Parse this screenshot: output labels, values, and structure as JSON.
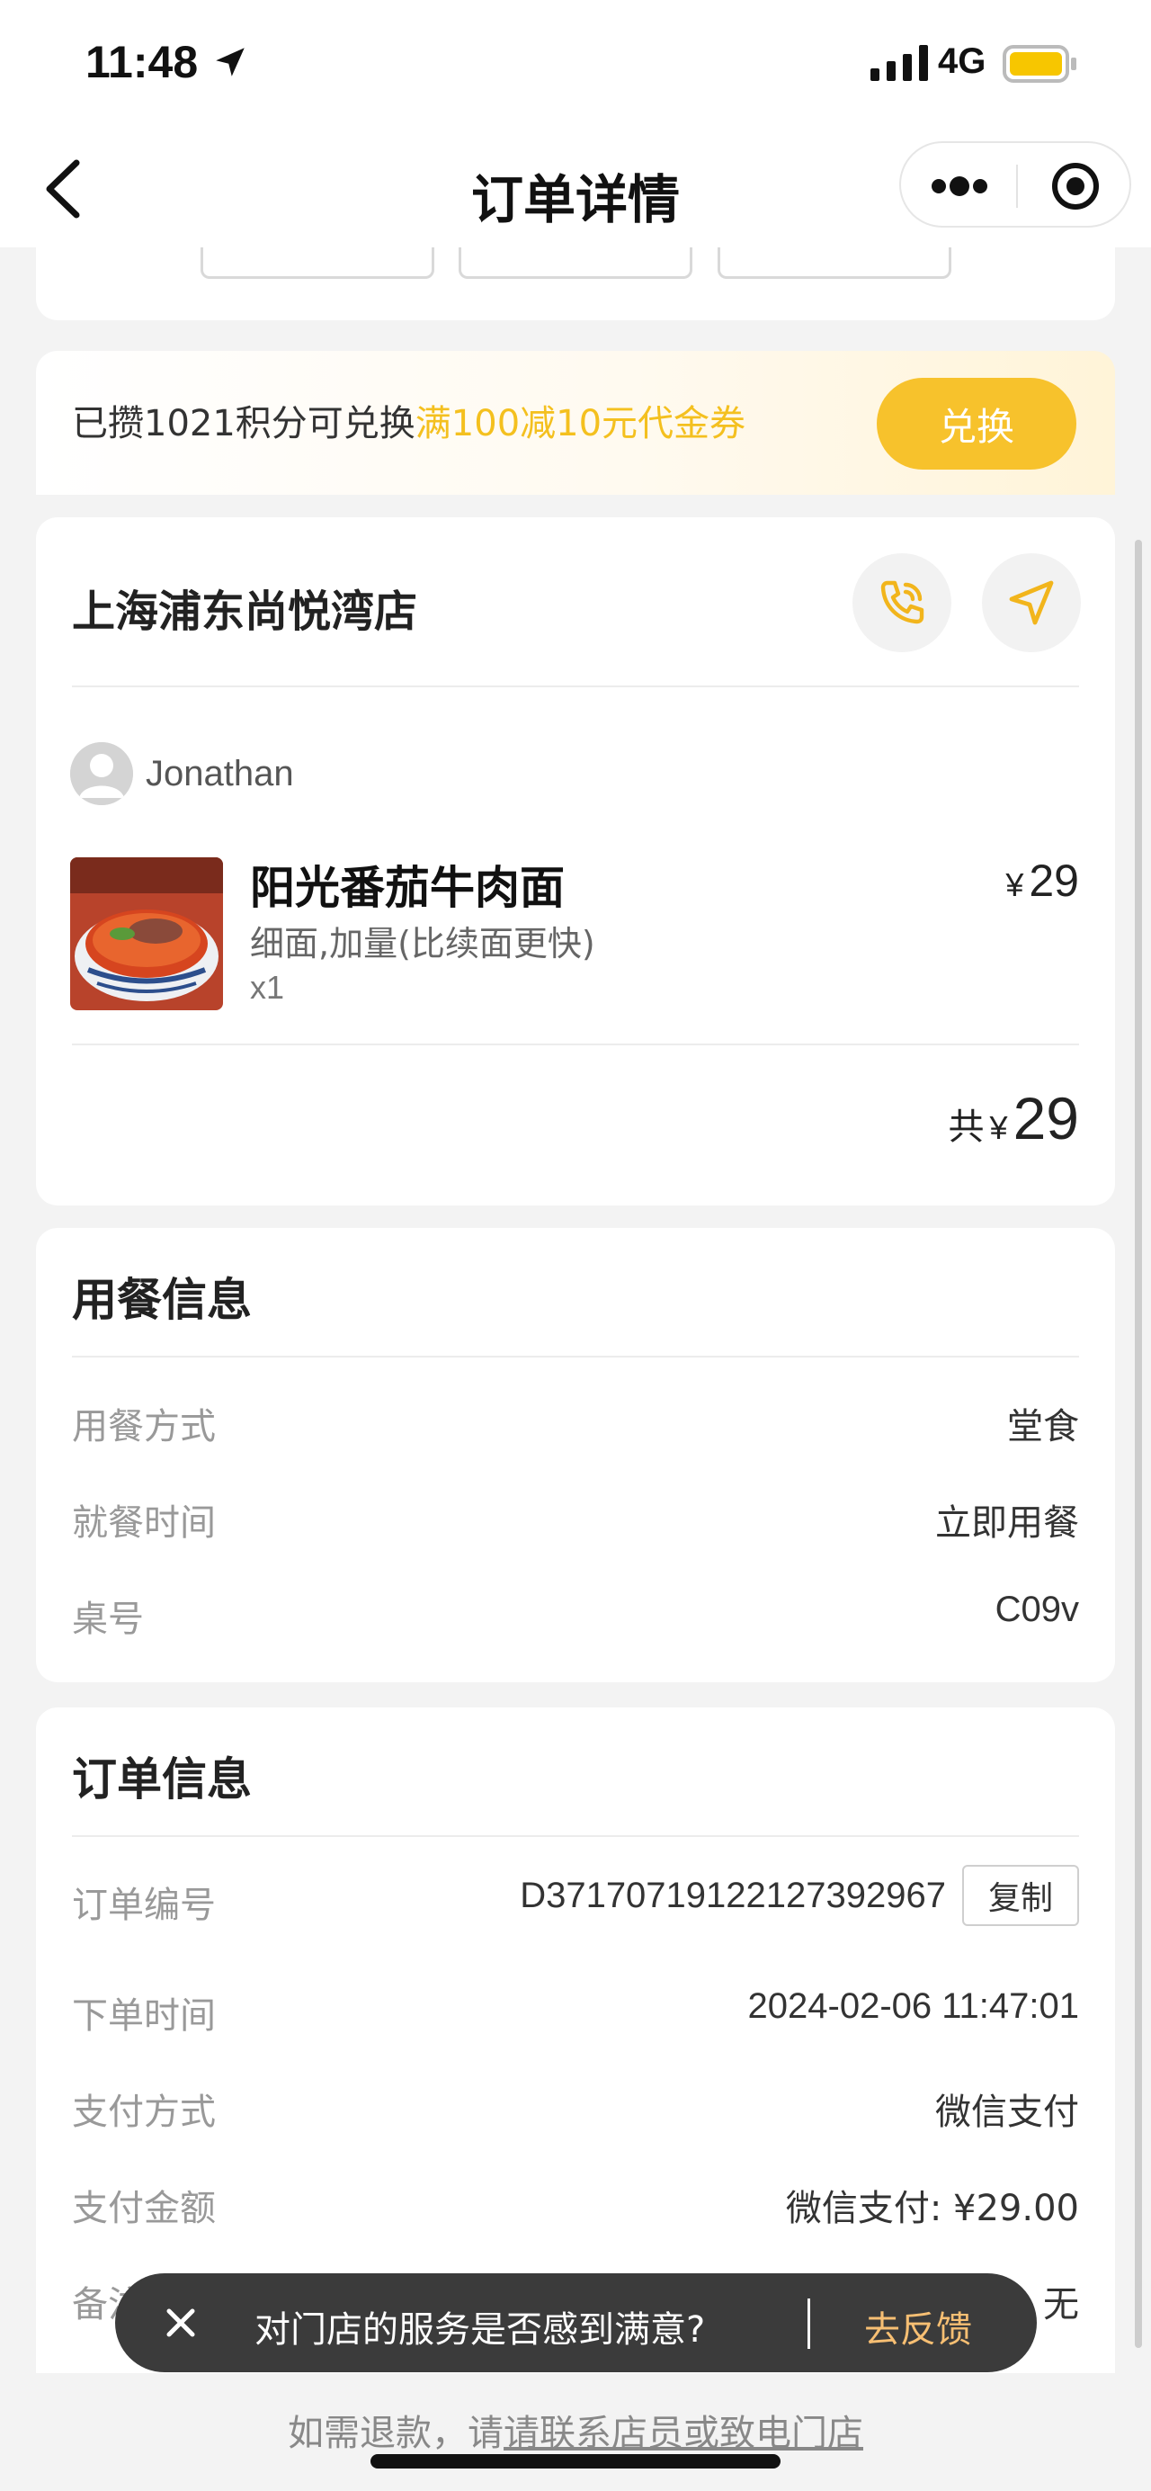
{
  "status_bar": {
    "time": "11:48",
    "network": "4G",
    "icons": [
      "location-arrow-icon",
      "signal-icon",
      "battery-icon"
    ],
    "battery_color": "#f7c600"
  },
  "nav": {
    "title": "订单详情",
    "icons": [
      "back-icon",
      "more-icon",
      "close-icon"
    ]
  },
  "points_banner": {
    "text_prefix": "已攒1021积分可兑换",
    "text_highlight": "满100减10元代金券",
    "redeem_label": "兑换",
    "accent": "#f7c22c"
  },
  "store": {
    "name": "上海浦东尚悦湾店",
    "icons": [
      "phone-icon",
      "navigation-icon"
    ],
    "user_name": "Jonathan",
    "item": {
      "name": "阳光番茄牛肉面",
      "options": "细面,加量(比续面更快)",
      "qty": "x1",
      "currency": "¥",
      "price": "29"
    },
    "total_label": "共",
    "total_currency": "¥",
    "total_amount": "29"
  },
  "dining": {
    "title": "用餐信息",
    "rows": [
      {
        "label": "用餐方式",
        "value": "堂食"
      },
      {
        "label": "就餐时间",
        "value": "立即用餐"
      },
      {
        "label": "桌号",
        "value": "C09v"
      }
    ]
  },
  "order": {
    "title": "订单信息",
    "order_no_label": "订单编号",
    "order_no_value": "D3717071912212739296​7",
    "copy_label": "复制",
    "rows": [
      {
        "label": "下单时间",
        "value": "2024-02-06 11:47:01"
      },
      {
        "label": "支付方式",
        "value": "微信支付"
      },
      {
        "label": "支付金额",
        "value": "微信支付: ¥29.00"
      },
      {
        "label": "备注信息",
        "value": "无"
      }
    ]
  },
  "feedback": {
    "question": "对门店的服务是否感到满意?",
    "link": "去反馈",
    "link_color": "#f7bf73"
  },
  "refund": {
    "prefix": "如需退款，请",
    "link": "请联系店员或致电门店"
  }
}
